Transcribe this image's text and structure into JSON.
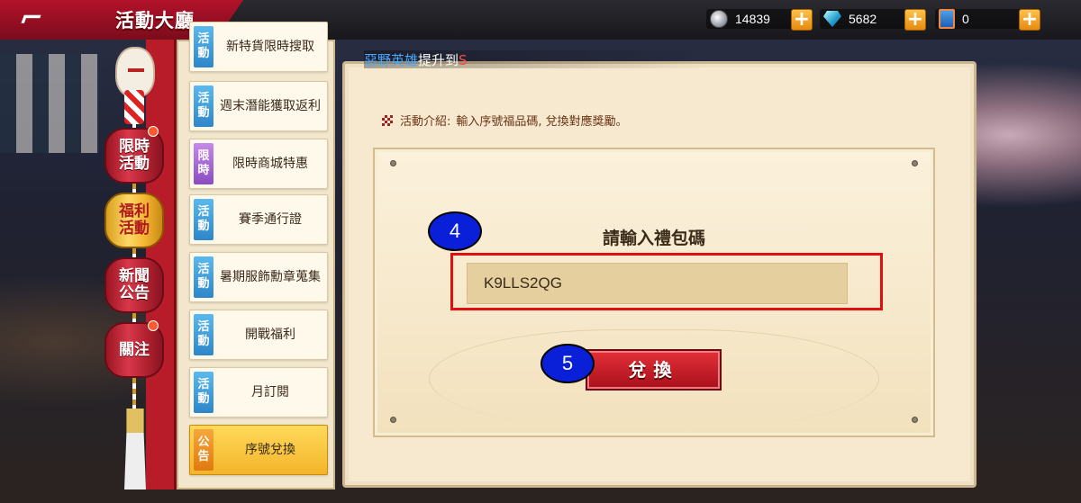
{
  "header": {
    "back_icon": "back-arrow-icon",
    "title": "活動大廳"
  },
  "resources": [
    {
      "name": "coins",
      "icon": "silver-coin-icon",
      "value": "14839"
    },
    {
      "name": "diamonds",
      "icon": "diamond-icon",
      "value": "5682"
    },
    {
      "name": "tickets",
      "icon": "ticket-book-icon",
      "value": "0"
    }
  ],
  "categories": [
    {
      "label": "限時活動",
      "active": false,
      "notification": true
    },
    {
      "label": "福利活動",
      "active": true,
      "notification": false
    },
    {
      "label": "新聞公告",
      "active": false,
      "notification": false
    },
    {
      "label": "關注",
      "active": false,
      "notification": true
    }
  ],
  "activity_list": [
    {
      "tag": "活動",
      "tag_color": "#2d86c9",
      "label": "新特貨限時搜取",
      "selected": false
    },
    {
      "tag": "活動",
      "tag_color": "#2d86c9",
      "label": "週末潛能獲取返利",
      "selected": false
    },
    {
      "tag": "限時",
      "tag_color": "#8a4cc0",
      "label": "限時商城特惠",
      "selected": false
    },
    {
      "tag": "活動",
      "tag_color": "#2d86c9",
      "label": "賽季通行證",
      "selected": false
    },
    {
      "tag": "活動",
      "tag_color": "#2d86c9",
      "label": "暑期服飾勳章蒐集",
      "selected": false
    },
    {
      "tag": "活動",
      "tag_color": "#2d86c9",
      "label": "開戰福利",
      "selected": false
    },
    {
      "tag": "活動",
      "tag_color": "#2d86c9",
      "label": "月訂閱",
      "selected": false
    },
    {
      "tag": "公告",
      "tag_color": "#e07a10",
      "label": "序號兌換",
      "selected": true
    }
  ],
  "ticker": {
    "name": "惡野英雄",
    "text": "提升到"
  },
  "panel": {
    "intro_label": "活動介紹:",
    "intro_text": "輸入序號福品碼, 兌換對應獎勵。",
    "prompt": "請輸入禮包碼",
    "code_value": "K9LLS2QG",
    "redeem_label": "兌換"
  },
  "annotations": {
    "step_input": "4",
    "step_button": "5",
    "highlight_color": "#e01010",
    "badge_color": "#0a1fd8"
  }
}
